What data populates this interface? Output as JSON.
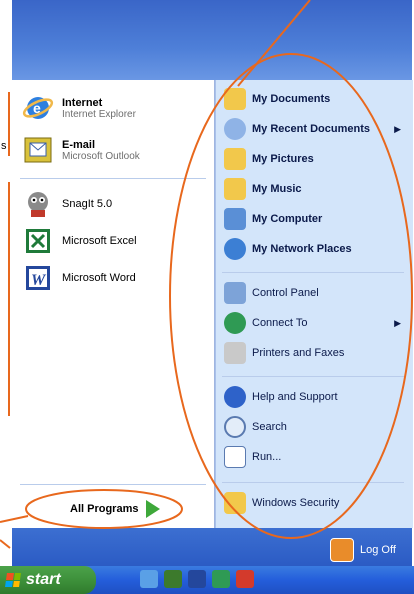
{
  "left_pinned": [
    {
      "title": "Internet",
      "subtitle": "Internet Explorer",
      "icon": "internet-explorer-icon"
    },
    {
      "title": "E-mail",
      "subtitle": "Microsoft Outlook",
      "icon": "outlook-icon"
    }
  ],
  "left_recent": [
    {
      "label": "SnagIt 5.0",
      "icon": "snagit-icon"
    },
    {
      "label": "Microsoft Excel",
      "icon": "excel-icon"
    },
    {
      "label": "Microsoft Word",
      "icon": "word-icon"
    }
  ],
  "all_programs_label": "All Programs",
  "right_items": [
    {
      "label": "My Documents",
      "bold": true,
      "icon": "folder-documents-icon"
    },
    {
      "label": "My Recent Documents",
      "bold": true,
      "icon": "recent-documents-icon",
      "submenu": true
    },
    {
      "label": "My Pictures",
      "bold": true,
      "icon": "folder-pictures-icon"
    },
    {
      "label": "My Music",
      "bold": true,
      "icon": "folder-music-icon"
    },
    {
      "label": "My Computer",
      "bold": true,
      "icon": "computer-icon"
    },
    {
      "label": "My Network Places",
      "bold": true,
      "icon": "network-icon"
    },
    {
      "label": "Control Panel",
      "bold": false,
      "icon": "control-panel-icon"
    },
    {
      "label": "Connect To",
      "bold": false,
      "icon": "connect-icon",
      "submenu": true
    },
    {
      "label": "Printers and Faxes",
      "bold": false,
      "icon": "printer-icon"
    },
    {
      "label": "Help and Support",
      "bold": false,
      "icon": "help-icon"
    },
    {
      "label": "Search",
      "bold": false,
      "icon": "search-icon"
    },
    {
      "label": "Run...",
      "bold": false,
      "icon": "run-icon"
    },
    {
      "label": "Windows Security",
      "bold": false,
      "icon": "security-icon"
    }
  ],
  "log_off_label": "Log Off",
  "start_label": "start",
  "side_fragment": "s",
  "colors": {
    "accent": "#e8681d",
    "right_bg": "#d3e5fa",
    "header": "#3a66c8"
  }
}
